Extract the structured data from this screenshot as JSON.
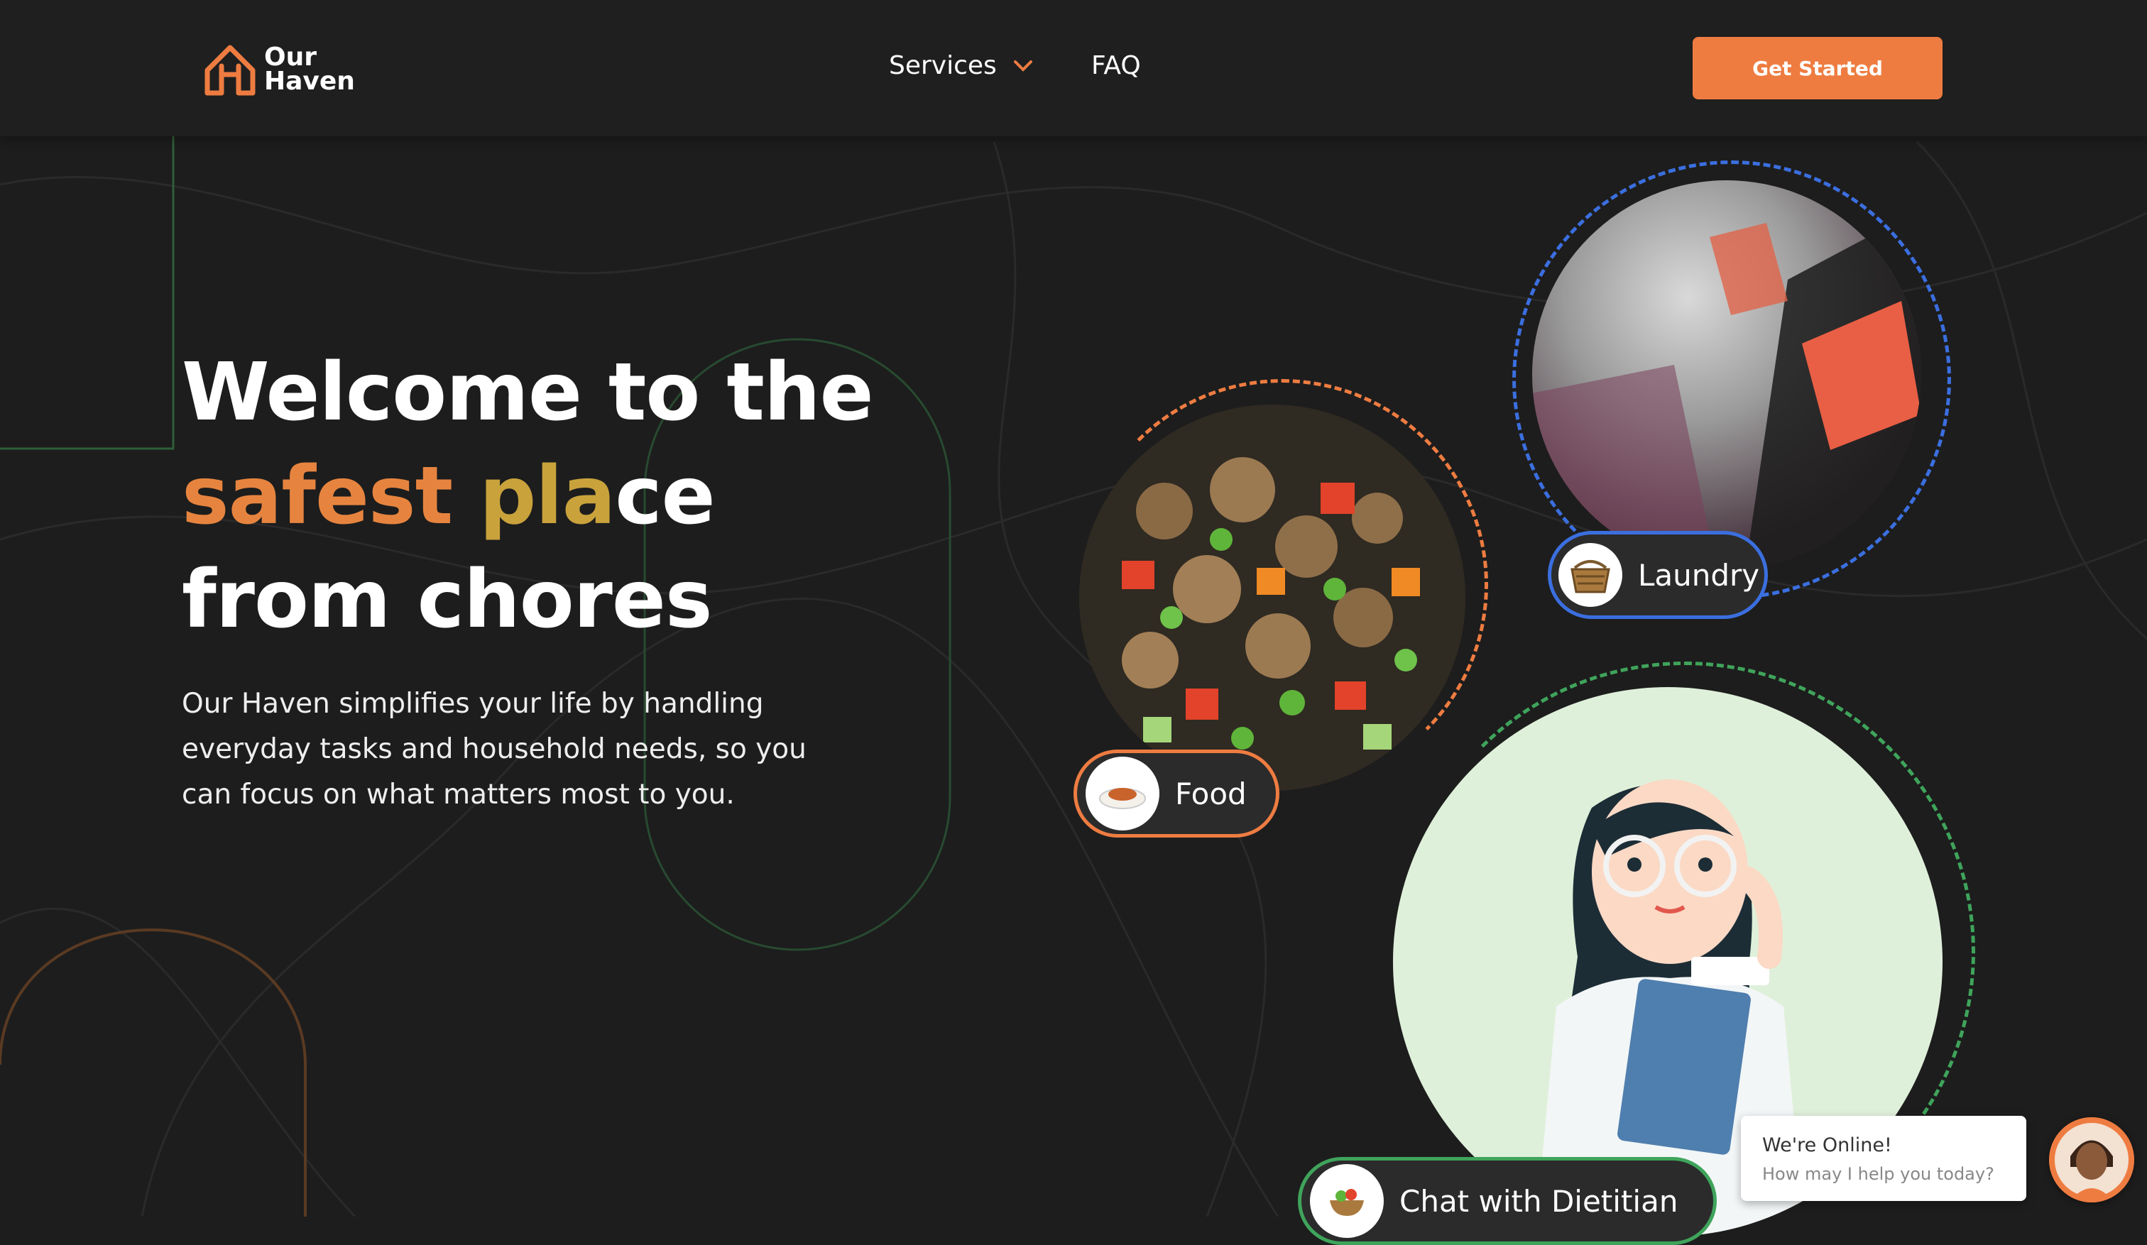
{
  "brand": {
    "name_line1": "Our",
    "name_line2": "Haven"
  },
  "nav": {
    "services": "Services",
    "faq": "FAQ"
  },
  "cta": {
    "label": "Get Started"
  },
  "hero": {
    "line1": "Welcome to the",
    "line2_orange": "safest ",
    "line2_gold": "pla",
    "line2_white": "ce",
    "line3": "from chores",
    "description": "Our Haven simplifies your life by handling everyday tasks and household needs, so you can focus on what matters most to you."
  },
  "services": {
    "food": "Food",
    "laundry": "Laundry",
    "dietitian": "Chat with Dietitian"
  },
  "chat": {
    "title": "We're Online!",
    "subtitle": "How may I help you today?"
  },
  "colors": {
    "background": "#1d1d1d",
    "accent_orange": "#ee7c41",
    "gold": "#c9a23c",
    "laundry_blue": "#3b6fe0",
    "dietitian_green": "#3fa45b",
    "dietitian_bg": "#dff0da"
  },
  "icons": [
    "chevron-down-icon",
    "house-logo-icon",
    "food-plate-icon",
    "laundry-basket-icon",
    "salad-icon"
  ]
}
